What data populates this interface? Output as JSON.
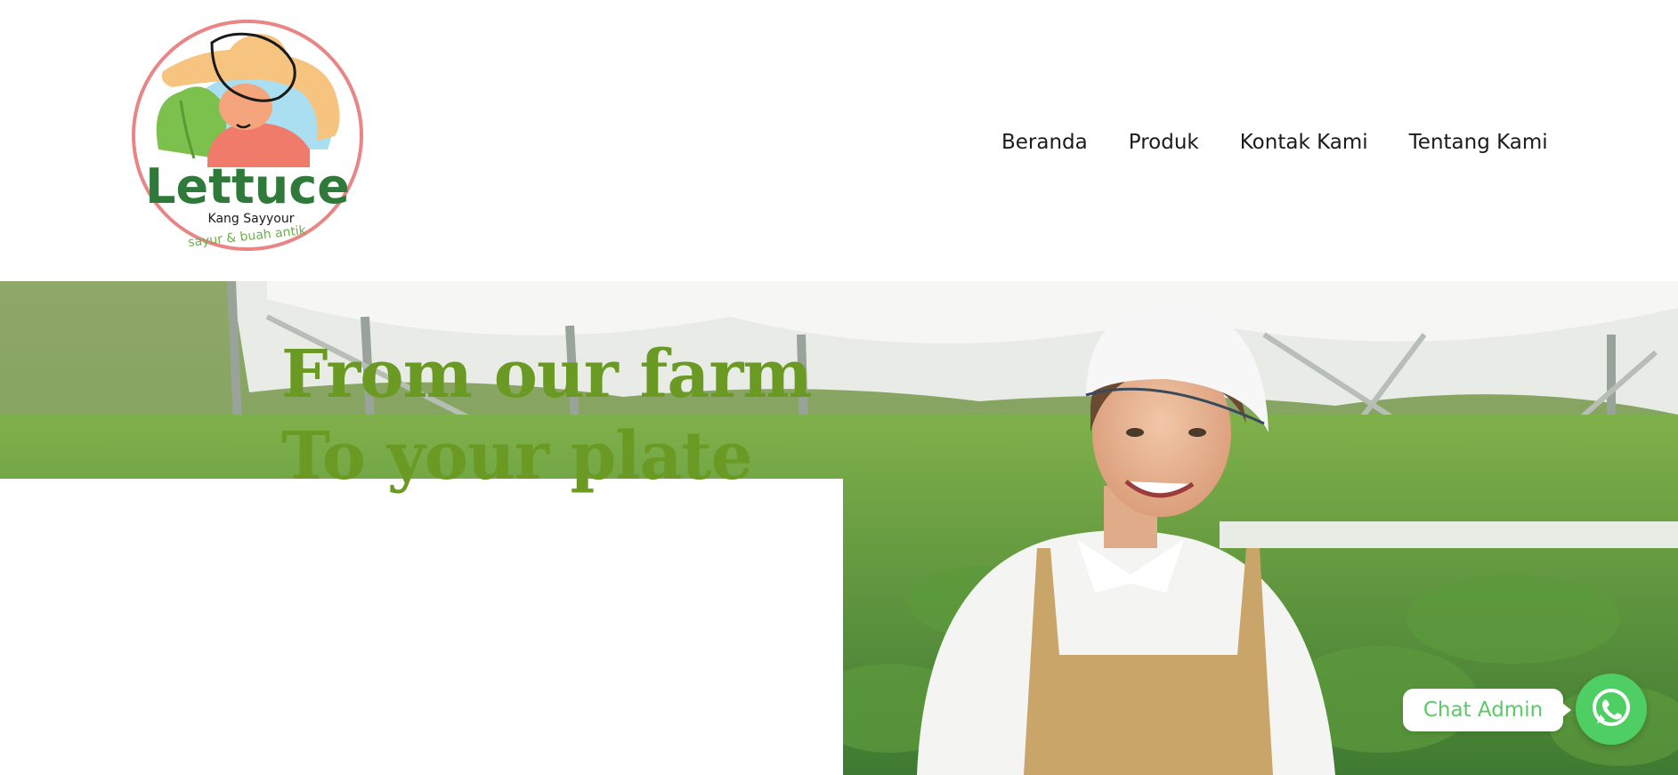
{
  "brand": {
    "name": "Lettuce",
    "tagline": "Kang Sayyour",
    "subtitle": "sayur & buah antik",
    "colors": {
      "green": "#2f7a3a",
      "pink": "#e98585",
      "hat": "#f6c47e",
      "sky": "#a9dff0"
    }
  },
  "nav": {
    "items": [
      {
        "label": "Beranda"
      },
      {
        "label": "Produk"
      },
      {
        "label": "Kontak Kami"
      },
      {
        "label": "Tentang Kami"
      }
    ]
  },
  "hero": {
    "title_line1": "From our farm",
    "title_line2": "To your plate",
    "title_color": "#6a9a23",
    "image": "farmer-woman-greenhouse-photo"
  },
  "chat": {
    "label": "Chat Admin",
    "icon": "whatsapp-icon",
    "color": "#4fcf63"
  }
}
